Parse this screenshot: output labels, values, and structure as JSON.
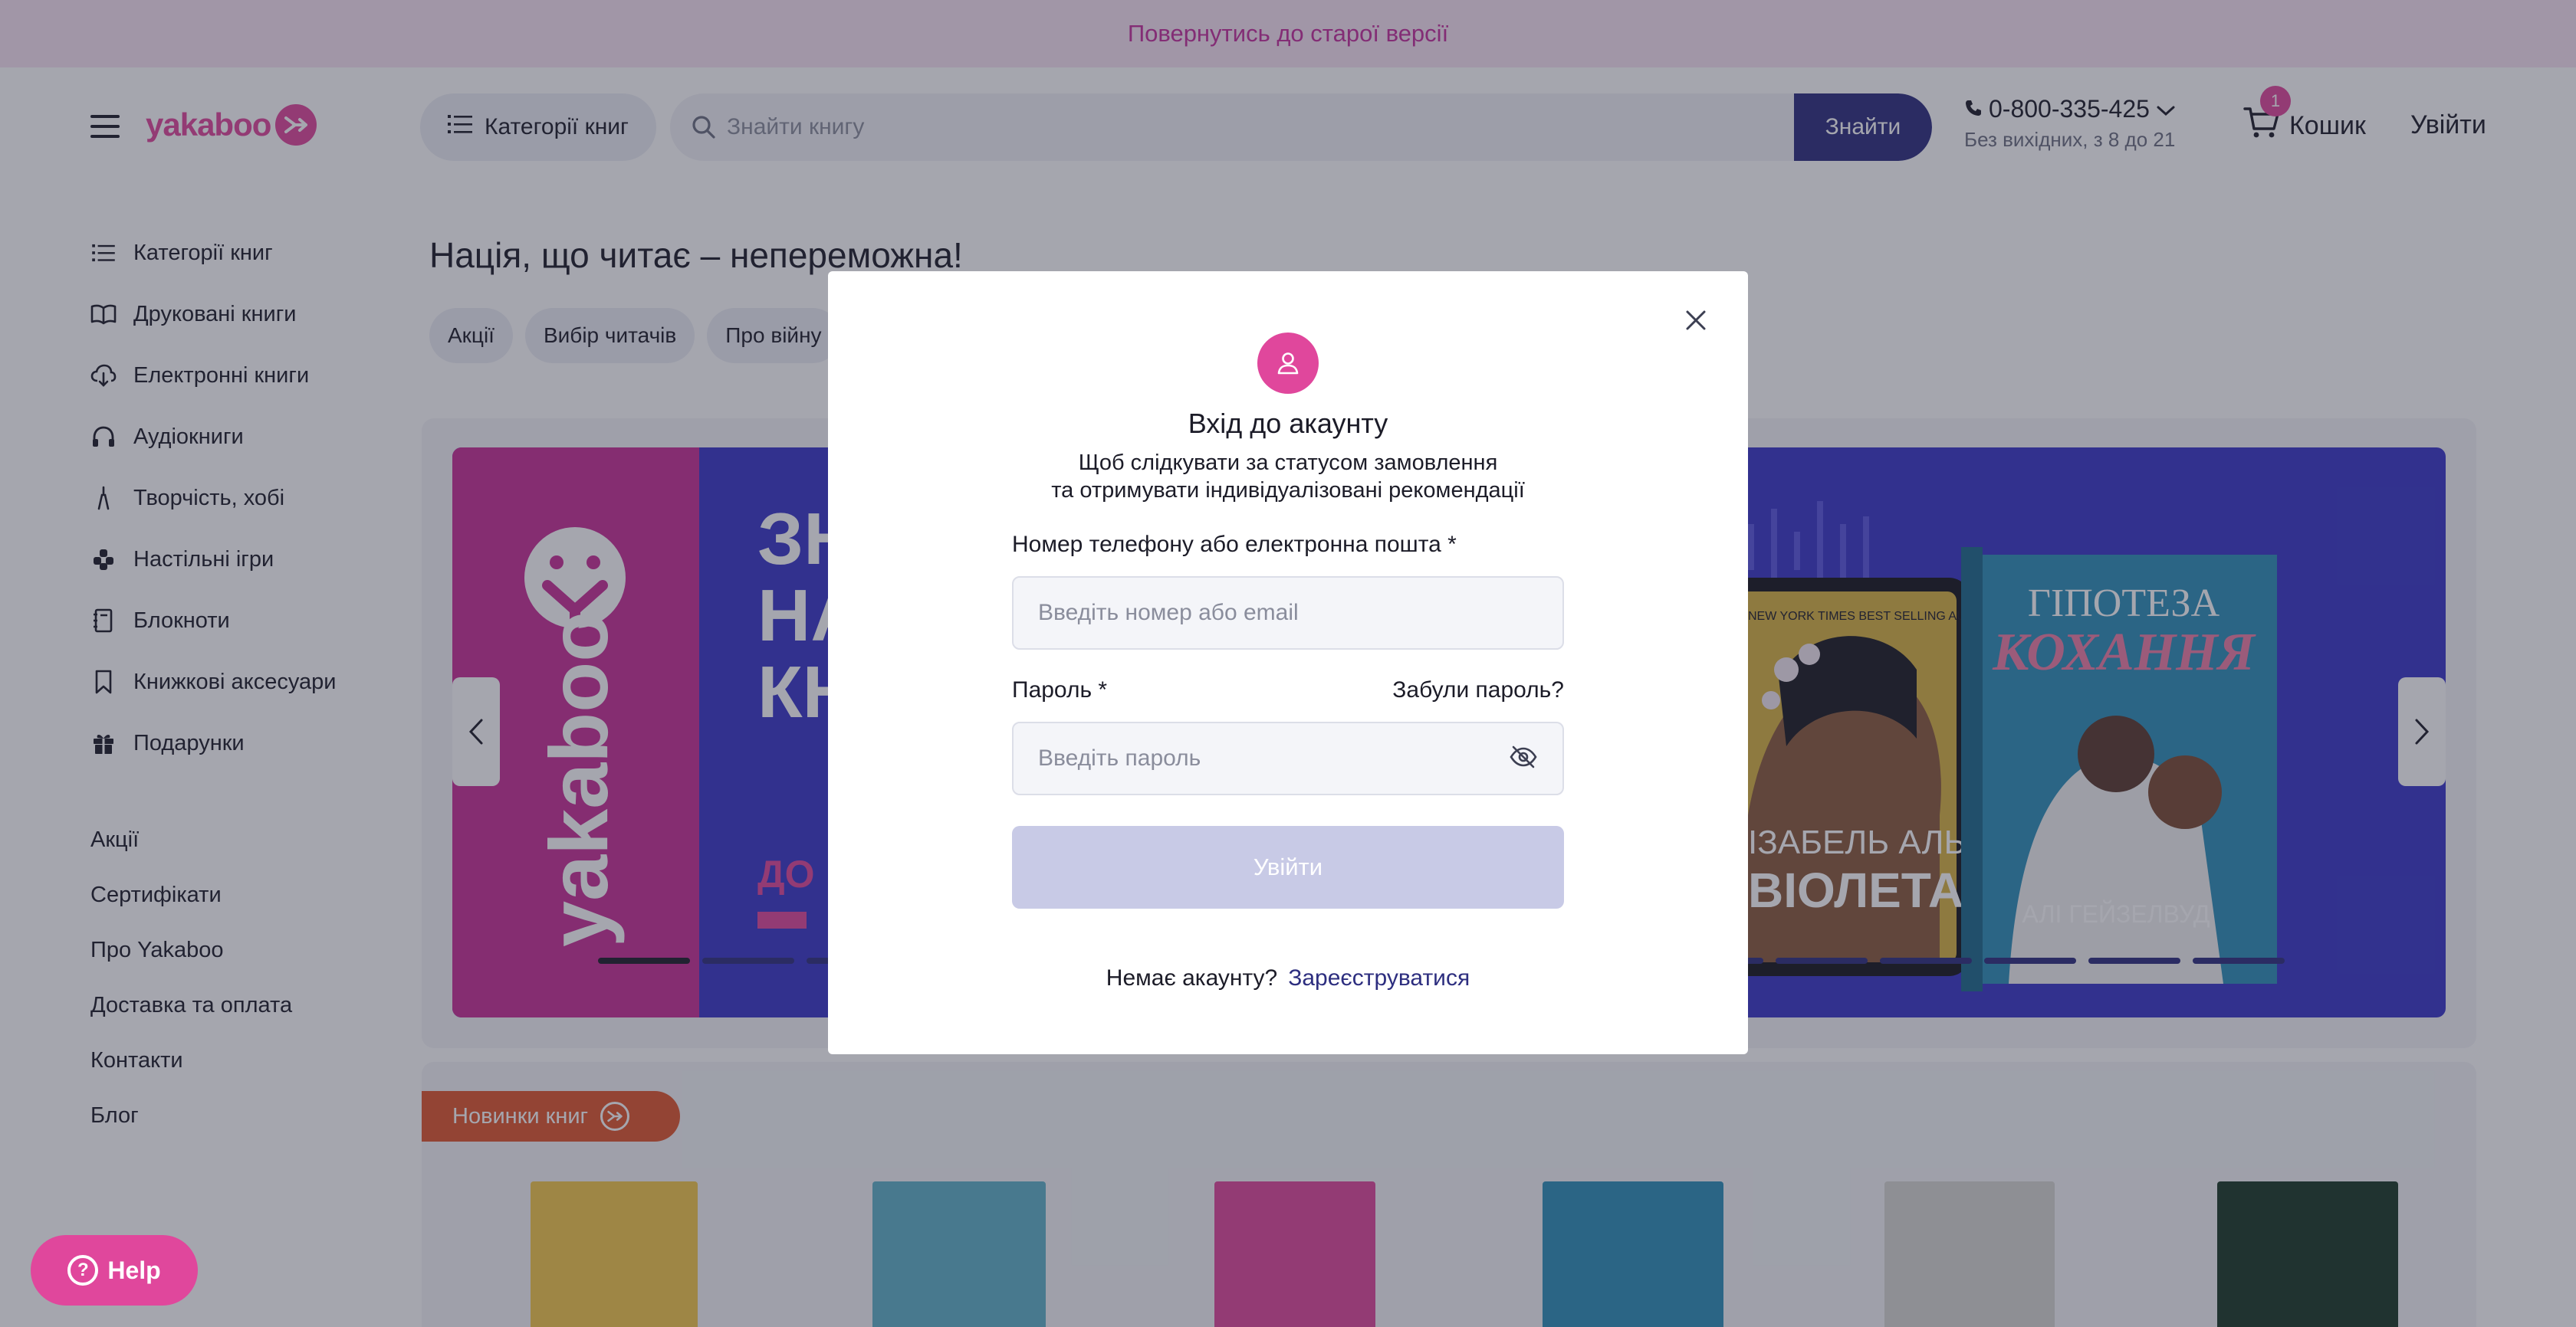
{
  "top_banner": {
    "link": "Повернутись до старої версії"
  },
  "header": {
    "logo": "yakaboo",
    "categories_button": "Категорії книг",
    "search": {
      "placeholder": "Знайти книгу",
      "value": "",
      "button": "Знайти"
    },
    "phone": {
      "number": "0-800-335-425",
      "hours": "Без вихідних, з 8 до 21"
    },
    "cart": {
      "label": "Кошик",
      "count": "1"
    },
    "login": "Увійти"
  },
  "sidebar": {
    "items": [
      {
        "label": "Категорії книг",
        "icon": "list-icon"
      },
      {
        "label": "Друковані книги",
        "icon": "book-icon"
      },
      {
        "label": "Електронні книги",
        "icon": "cloud-download-icon"
      },
      {
        "label": "Аудіокниги",
        "icon": "headphones-icon"
      },
      {
        "label": "Творчість, хобі",
        "icon": "brush-icon"
      },
      {
        "label": "Настільні ігри",
        "icon": "puzzle-icon"
      },
      {
        "label": "Блокноти",
        "icon": "notebook-icon"
      },
      {
        "label": "Книжкові аксесуари",
        "icon": "bookmark-icon"
      },
      {
        "label": "Подарунки",
        "icon": "gift-icon"
      }
    ],
    "links": [
      "Акції",
      "Сертифікати",
      "Про Yakaboo",
      "Доставка та оплата",
      "Контакти",
      "Блог"
    ]
  },
  "main": {
    "title": "Нація, що читає – непереможна!",
    "chips": [
      "Акції",
      "Вибір читачів",
      "Про війну"
    ],
    "banner": {
      "headline": [
        "ЗН",
        "НА",
        "КН"
      ],
      "promo": "ДО",
      "book_title": "ГІПОТЕЗА КОХАННЯ",
      "book_author": "АЛІ ГЕЙЗЕЛВУД",
      "book2_title": "ВІОЛЕТА",
      "book2_author": "ІЗАБЕЛЬ АЛЬЄНДЕ",
      "book_tagline": "NEW YORK TIMES BEST SELLING AUTHOR"
    },
    "news_label": "Новинки книг"
  },
  "help": {
    "label": "Help"
  },
  "modal": {
    "title": "Вхід до акаунту",
    "subtitle_line1": "Щоб слідкувати за статусом замовлення",
    "subtitle_line2": "та отримувати індивідуалізовані рекомендації",
    "login_label": "Номер телефону або електронна пошта *",
    "login_placeholder": "Введіть номер або email",
    "password_label": "Пароль *",
    "forgot": "Забули пароль?",
    "password_placeholder": "Введіть пароль",
    "submit": "Увійти",
    "no_account": "Немає акаунту?",
    "register": "Зареєструватися"
  },
  "colors": {
    "brand_pink": "#e0479c",
    "navy": "#2d2e7f",
    "orange": "#e1572e",
    "banner_blue": "#3a36c8"
  }
}
